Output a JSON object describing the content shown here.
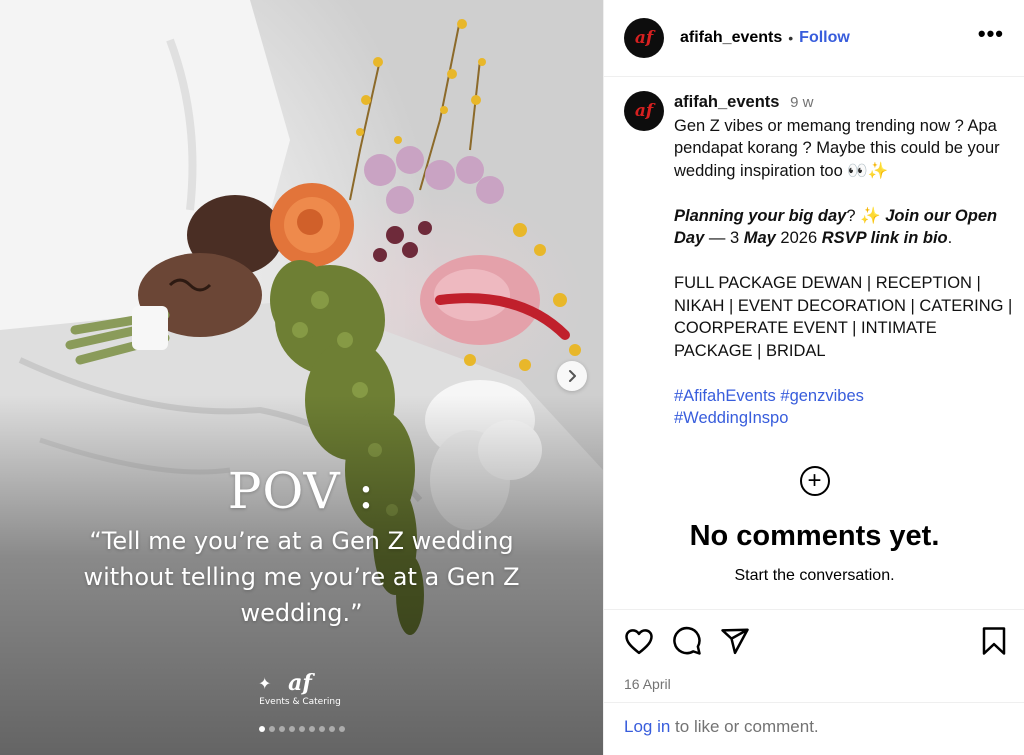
{
  "post": {
    "overlay_heading": "POV :",
    "overlay_quote": "“Tell me you’re at a Gen Z wedding without telling me you’re at a Gen Z wedding.”",
    "brand_mark": "af",
    "brand_tagline": "Events & Catering",
    "carousel": {
      "total_slides": 9,
      "active_index": 0
    },
    "next_icon": "chevron-right-icon"
  },
  "header": {
    "avatar_text": "af",
    "username": "afifah_events",
    "separator": "•",
    "follow_label": "Follow",
    "more_icon": "more-horizontal-icon"
  },
  "caption": {
    "avatar_text": "af",
    "username": "afifah_events",
    "time_ago": "9 w",
    "line1": "Gen Z vibes or memang trending now ? Apa pendapat korang ? Maybe this could be your wedding inspiration too 👀✨",
    "plan_a": "Planning your big day",
    "plan_b": "? ✨ ",
    "plan_c": "Join our Open Day",
    "plan_d": " — 3 ",
    "plan_e": "May",
    "plan_f": " 2026 ",
    "plan_g": "RSVP link in bio",
    "plan_h": ".",
    "packages": "FULL PACKAGE DEWAN | RECEPTION | NIKAH | EVENT DECORATION | CATERING | COORPERATE EVENT | INTIMATE PACKAGE | BRIDAL",
    "hashtags": [
      "#AfifahEvents",
      "#genzvibes",
      "#WeddingInspo"
    ]
  },
  "comments": {
    "add_icon": "add-circle-icon",
    "empty_title": "No comments yet.",
    "empty_subtitle": "Start the conversation."
  },
  "actions": {
    "like_icon": "heart-icon",
    "comment_icon": "comment-icon",
    "share_icon": "share-icon",
    "save_icon": "bookmark-icon",
    "date": "16 April"
  },
  "footer": {
    "login_label": "Log in",
    "rest": " to like or comment."
  },
  "colors": {
    "link_blue": "#385ddc",
    "muted_gray": "#737373",
    "avatar_bg": "#0d0d0d",
    "avatar_mark": "#d62020"
  }
}
